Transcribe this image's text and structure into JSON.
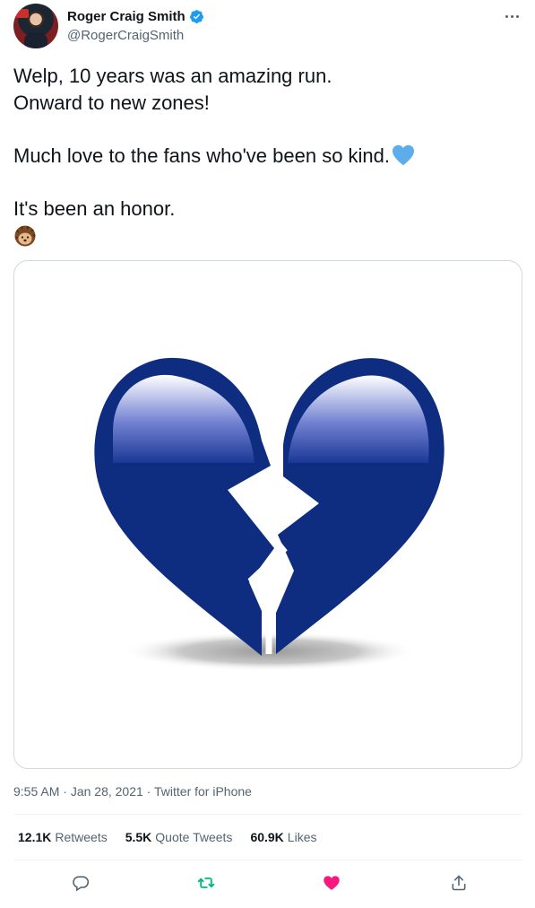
{
  "author": {
    "display_name": "Roger Craig Smith",
    "handle": "@RogerCraigSmith"
  },
  "tweet": {
    "lines": [
      "Welp, 10 years was an amazing run.",
      "Onward to new zones!",
      "Much love to the fans who've been so kind.",
      "It's been an honor."
    ],
    "emojis": [
      "blue-heart-icon",
      "hedgehog-icon"
    ]
  },
  "media": {
    "icon": "broken-heart-icon",
    "colors": {
      "heart": "#0f2d80",
      "outline": "#0a2470"
    }
  },
  "meta": {
    "time": "9:55 AM",
    "date": "Jan 28, 2021",
    "source": "Twitter for iPhone",
    "separator": " · "
  },
  "stats": {
    "retweets": {
      "count": "12.1K",
      "label": "Retweets"
    },
    "quote_tweets": {
      "count": "5.5K",
      "label": "Quote Tweets"
    },
    "likes": {
      "count": "60.9K",
      "label": "Likes"
    }
  },
  "actions": [
    "reply-icon",
    "retweet-icon",
    "like-icon",
    "share-icon"
  ],
  "colors": {
    "verified": "#1d9bf0",
    "retweet_green": "#00ba7c",
    "like_pink": "#f91880",
    "muted": "#536471"
  }
}
